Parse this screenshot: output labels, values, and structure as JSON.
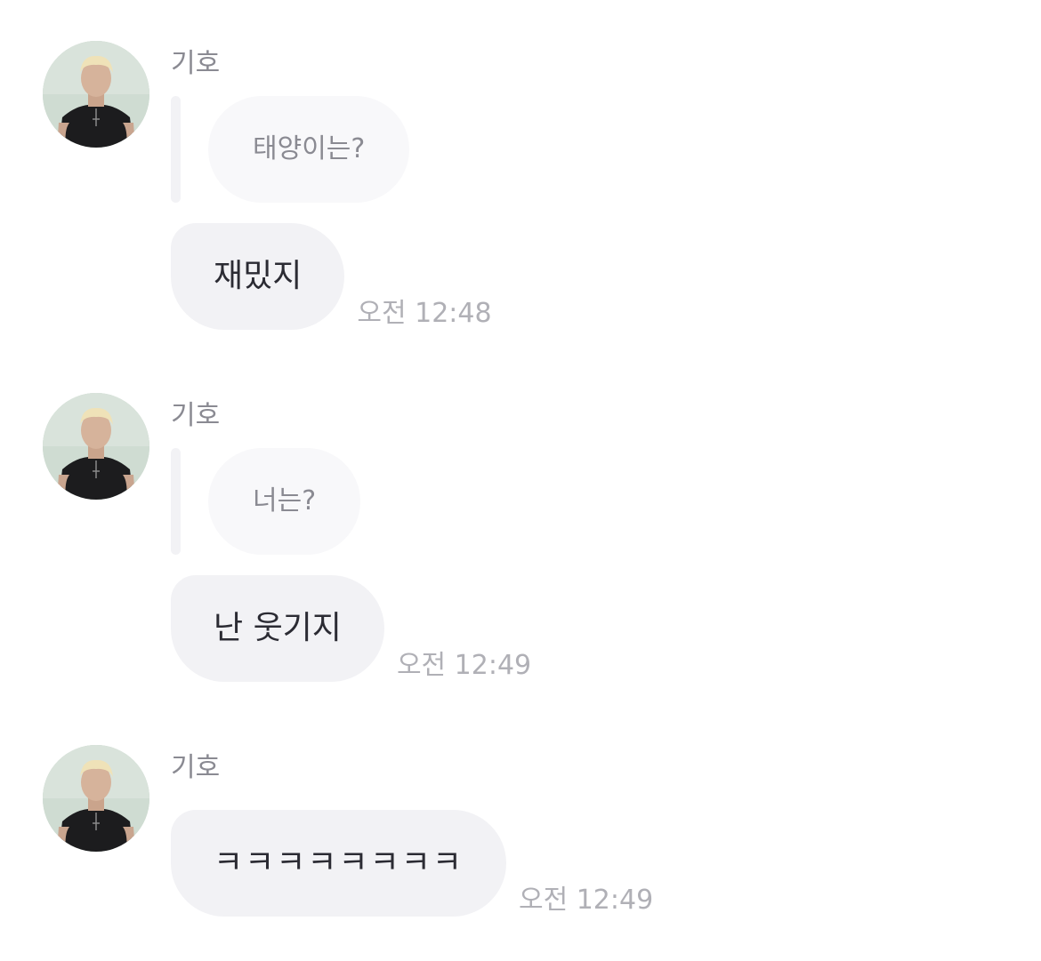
{
  "messages": [
    {
      "sender": "기호",
      "reply_to": "태양이는?",
      "text": "재밌지",
      "time": "오전 12:48"
    },
    {
      "sender": "기호",
      "reply_to": "너는?",
      "text": "난 웃기지",
      "time": "오전 12:49"
    },
    {
      "sender": "기호",
      "text": "ㅋㅋㅋㅋㅋㅋㅋㅋ",
      "time": "오전 12:49"
    }
  ],
  "colors": {
    "bubble": "#f2f2f5",
    "reply_bubble": "#f8f8fa",
    "sender_text": "#8a8a92",
    "time_text": "#b0b0b6"
  },
  "icons": {
    "avatar": "profile-photo"
  }
}
